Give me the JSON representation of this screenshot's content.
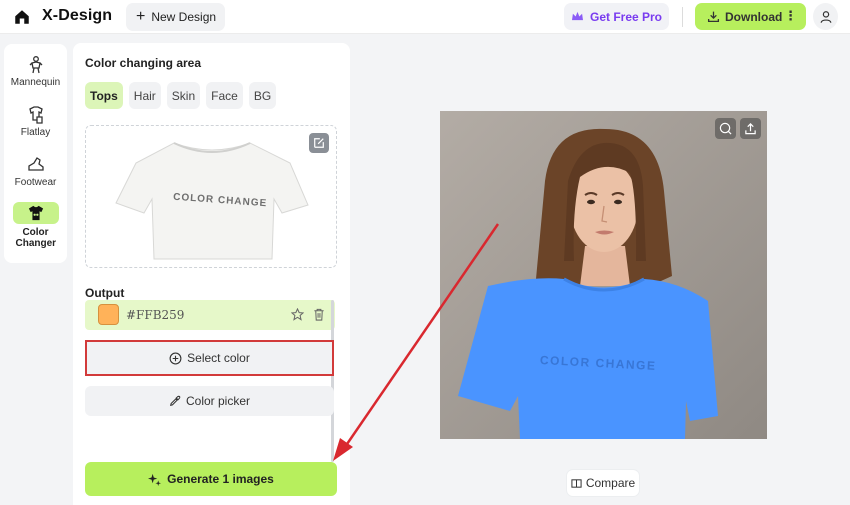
{
  "header": {
    "brand": "X-Design",
    "new_design": "New Design",
    "get_pro": "Get Free Pro",
    "download": "Download"
  },
  "leftnav": {
    "items": [
      {
        "label": "Mannequin",
        "icon": "mannequin-icon"
      },
      {
        "label": "Flatlay",
        "icon": "flatlay-icon"
      },
      {
        "label": "Footwear",
        "icon": "footwear-icon"
      },
      {
        "label": "Color Changer",
        "icon": "tshirt-icon",
        "active": true
      }
    ]
  },
  "panel": {
    "title": "Color changing area",
    "tabs": [
      "Tops",
      "Hair",
      "Skin",
      "Face",
      "BG"
    ],
    "active_tab": "Tops",
    "preview_text": "COLOR CHANGE",
    "output_label": "Output",
    "output_hex": "#FFB259",
    "output_color": "#FFB259",
    "select_color": "Select color",
    "color_picker": "Color picker",
    "generate": "Generate 1 images"
  },
  "canvas": {
    "shirt_text": "COLOR CHANGE",
    "shirt_color": "#4A94FF",
    "compare": "Compare"
  },
  "colors": {
    "accent_green": "#B7EF5D",
    "highlight_red": "#D23A3A",
    "pro_purple": "#7A3CF0"
  }
}
